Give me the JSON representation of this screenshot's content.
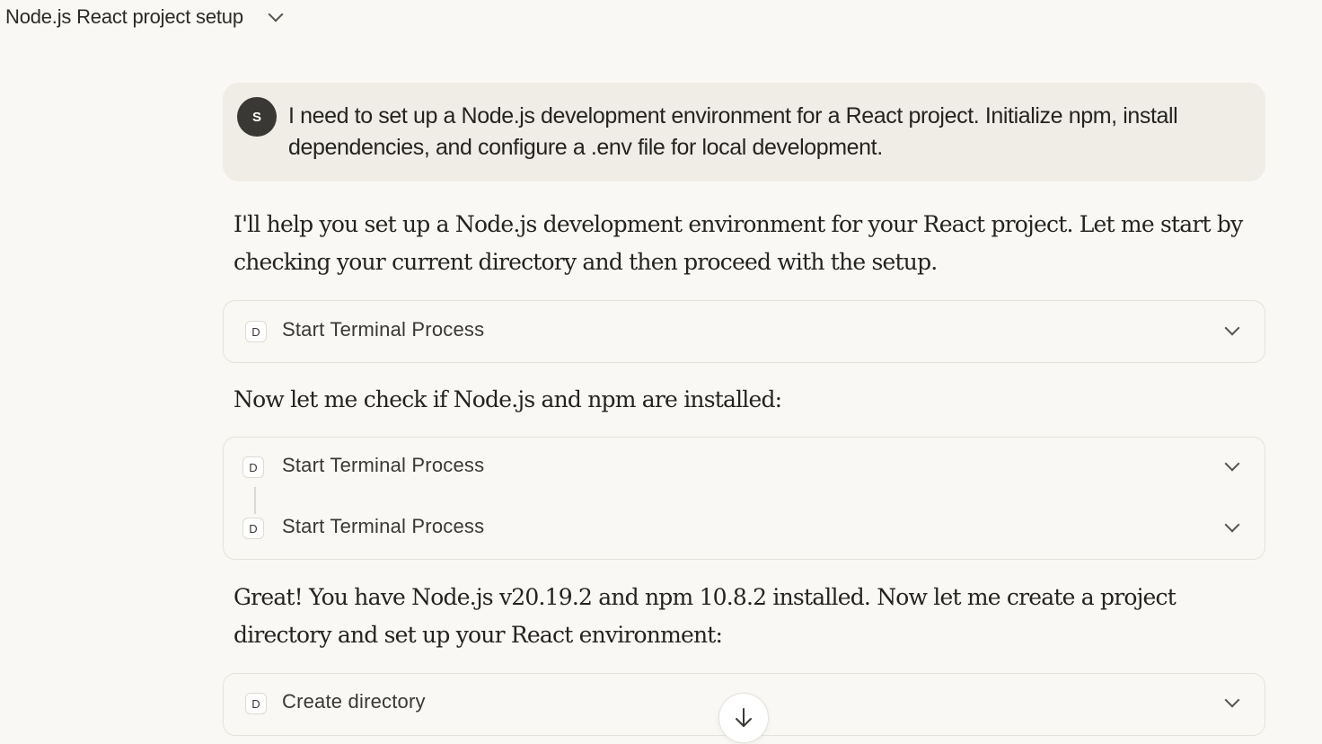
{
  "header": {
    "chat_title": "Node.js React project setup"
  },
  "user_message": {
    "avatar_initial": "S",
    "text": "I need to set up a Node.js development environment for a React project. Initialize npm, install dependencies, and configure a .env file for local development."
  },
  "messages": {
    "assistant_1": "I'll help you set up a Node.js development environment for your React project. Let me start by checking your current directory and then proceed with the setup.",
    "assistant_2": "Now let me check if Node.js and npm are installed:",
    "assistant_3": "Great! You have Node.js v20.19.2 and npm 10.8.2 installed. Now let me create a project directory and set up your React environment:"
  },
  "tools": {
    "call_1": {
      "badge": "D",
      "label": "Start Terminal Process"
    },
    "group": [
      {
        "badge": "D",
        "label": "Start Terminal Process"
      },
      {
        "badge": "D",
        "label": "Start Terminal Process"
      }
    ],
    "call_4": {
      "badge": "D",
      "label": "Create directory"
    }
  },
  "icons": {
    "title_dropdown": "chevron-down-icon",
    "expand": "chevron-down-icon",
    "scroll_down": "arrow-down-icon"
  },
  "colors": {
    "background": "#f9f8f4",
    "user_bubble": "#efede6",
    "avatar": "#3a3835",
    "card_border": "#e4e2da",
    "text": "#24231f"
  }
}
